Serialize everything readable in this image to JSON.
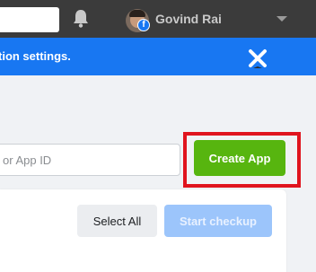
{
  "header": {
    "user_name": "Govind Rai",
    "badge_letter": "f"
  },
  "notice": {
    "text": "tion settings."
  },
  "app_search": {
    "placeholder": "or App ID"
  },
  "actions": {
    "create_app_label": "Create App",
    "select_all_label": "Select All",
    "start_checkup_label": "Start checkup"
  },
  "colors": {
    "topbar": "#3b3b3b",
    "notice_bar": "#1877f2",
    "create_button": "#57b50f",
    "highlight_frame": "#e0141e",
    "checkup_disabled": "#9cc5fb"
  },
  "icons": {
    "bell": "bell-icon",
    "close": "close-icon",
    "caret": "chevron-down-icon"
  }
}
